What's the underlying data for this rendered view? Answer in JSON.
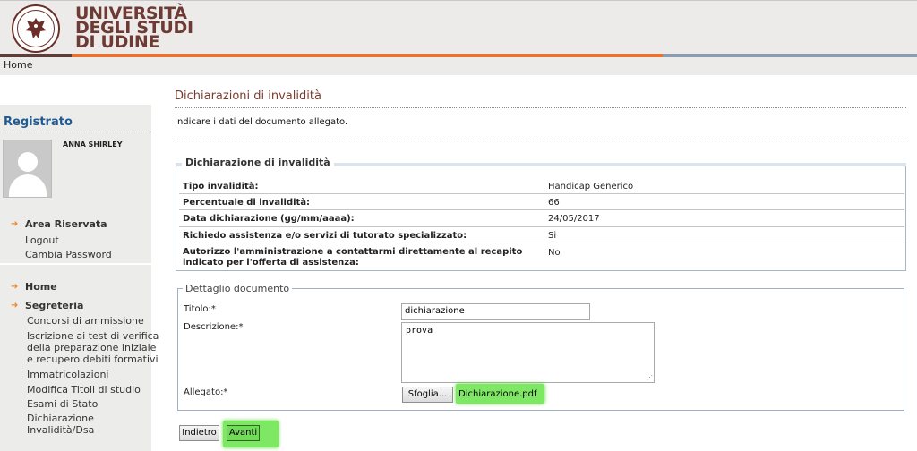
{
  "header": {
    "logo_lines": [
      "UNIVERSITÀ",
      "DEGLI STUDI",
      "DI UDINE"
    ],
    "seal_text": "VERITAS STUDIO OMNIA"
  },
  "topnav": {
    "home": "Home"
  },
  "sidebar": {
    "title": "Registrato",
    "user_name": "ANNA SHIRLEY",
    "area_riservata": "Area Riservata",
    "logout": "Logout",
    "cambia_password": "Cambia Password",
    "home": "Home",
    "segreteria": "Segreteria",
    "segreteria_items": [
      "Concorsi di ammissione",
      "Iscrizione ai test di verifica",
      "della preparazione iniziale",
      "e recupero debiti formativi",
      "Immatricolazioni",
      "Modifica Titoli di studio",
      "Esami di Stato",
      "Dichiarazione",
      "Invalidità/Dsa"
    ]
  },
  "main": {
    "title": "Dichiarazioni di invalidità",
    "intro": "Indicare i dati del documento allegato."
  },
  "invalidity": {
    "legend": "Dichiarazione di invalidità",
    "rows": [
      {
        "label": "Tipo invalidità:",
        "value": "Handicap Generico"
      },
      {
        "label": "Percentuale di invalidità:",
        "value": "66"
      },
      {
        "label": "Data dichiarazione (gg/mm/aaaa):",
        "value": "24/05/2017"
      },
      {
        "label": "Richiedo assistenza e/o servizi di tutorato specializzato:",
        "value": "Si"
      },
      {
        "label_line1": "Autorizzo l'amministrazione a contattarmi direttamente al recapito",
        "label_line2": "indicato per l'offerta di assistenza:",
        "value": "No"
      }
    ]
  },
  "document": {
    "legend": "Dettaglio documento",
    "titolo_label": "Titolo:*",
    "titolo_value": "dichiarazione",
    "descrizione_label": "Descrizione:*",
    "descrizione_value": "prova",
    "allegato_label": "Allegato:*",
    "browse_label": "Sfoglia...",
    "file_name": "Dichiarazione.pdf"
  },
  "actions": {
    "back": "Indietro",
    "next": "Avanti"
  },
  "colors": {
    "orange": "#ec7030",
    "brown": "#6d3a34",
    "blue_title": "#1f5a93",
    "highlight": "#7ee864"
  }
}
